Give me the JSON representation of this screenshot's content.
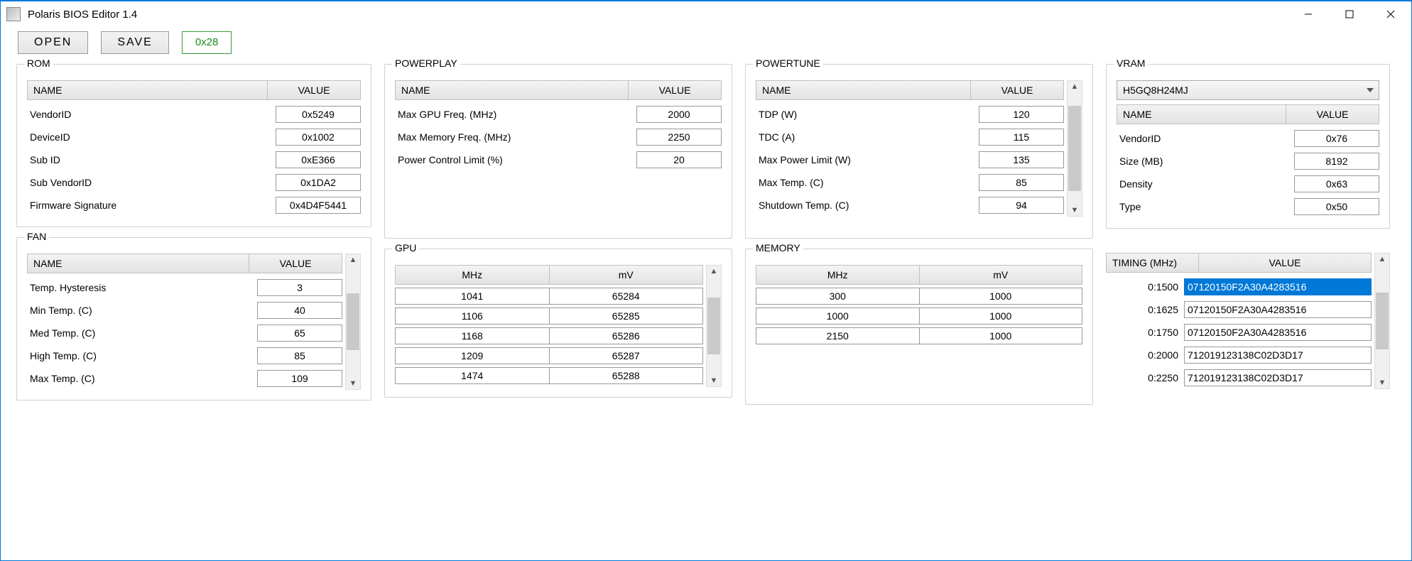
{
  "window": {
    "title": "Polaris BIOS Editor 1.4"
  },
  "toolbar": {
    "open": "OPEN",
    "save": "SAVE",
    "checksum": "0x28"
  },
  "rom": {
    "legend": "ROM",
    "headers": {
      "name": "NAME",
      "value": "VALUE"
    },
    "rows": [
      {
        "name": "VendorID",
        "value": "0x5249"
      },
      {
        "name": "DeviceID",
        "value": "0x1002"
      },
      {
        "name": "Sub ID",
        "value": "0xE366"
      },
      {
        "name": "Sub VendorID",
        "value": "0x1DA2"
      },
      {
        "name": "Firmware Signature",
        "value": "0x4D4F5441"
      }
    ]
  },
  "powerplay": {
    "legend": "POWERPLAY",
    "headers": {
      "name": "NAME",
      "value": "VALUE"
    },
    "rows": [
      {
        "name": "Max GPU Freq. (MHz)",
        "value": "2000"
      },
      {
        "name": "Max Memory Freq. (MHz)",
        "value": "2250"
      },
      {
        "name": "Power Control Limit (%)",
        "value": "20"
      }
    ]
  },
  "powertune": {
    "legend": "POWERTUNE",
    "headers": {
      "name": "NAME",
      "value": "VALUE"
    },
    "rows": [
      {
        "name": "TDP (W)",
        "value": "120"
      },
      {
        "name": "TDC (A)",
        "value": "115"
      },
      {
        "name": "Max Power Limit (W)",
        "value": "135"
      },
      {
        "name": "Max Temp. (C)",
        "value": "85"
      },
      {
        "name": "Shutdown Temp. (C)",
        "value": "94"
      }
    ]
  },
  "vram": {
    "legend": "VRAM",
    "selected": "H5GQ8H24MJ",
    "headers": {
      "name": "NAME",
      "value": "VALUE"
    },
    "rows": [
      {
        "name": "VendorID",
        "value": "0x76"
      },
      {
        "name": "Size (MB)",
        "value": "8192"
      },
      {
        "name": "Density",
        "value": "0x63"
      },
      {
        "name": "Type",
        "value": "0x50"
      }
    ]
  },
  "fan": {
    "legend": "FAN",
    "headers": {
      "name": "NAME",
      "value": "VALUE"
    },
    "rows": [
      {
        "name": "Temp. Hysteresis",
        "value": "3"
      },
      {
        "name": "Min Temp. (C)",
        "value": "40"
      },
      {
        "name": "Med Temp. (C)",
        "value": "65"
      },
      {
        "name": "High Temp. (C)",
        "value": "85"
      },
      {
        "name": "Max Temp. (C)",
        "value": "109"
      }
    ]
  },
  "gpu": {
    "legend": "GPU",
    "headers": {
      "c1": "MHz",
      "c2": "mV"
    },
    "rows": [
      {
        "mhz": "1041",
        "mv": "65284"
      },
      {
        "mhz": "1106",
        "mv": "65285"
      },
      {
        "mhz": "1168",
        "mv": "65286"
      },
      {
        "mhz": "1209",
        "mv": "65287"
      },
      {
        "mhz": "1474",
        "mv": "65288"
      }
    ]
  },
  "memory": {
    "legend": "MEMORY",
    "headers": {
      "c1": "MHz",
      "c2": "mV"
    },
    "rows": [
      {
        "mhz": "300",
        "mv": "1000"
      },
      {
        "mhz": "1000",
        "mv": "1000"
      },
      {
        "mhz": "2150",
        "mv": "1000"
      }
    ]
  },
  "timing": {
    "headers": {
      "c1": "TIMING (MHz)",
      "c2": "VALUE"
    },
    "rows": [
      {
        "strap": "0:1500",
        "value": "07120150F2A30A4283516",
        "selected": true
      },
      {
        "strap": "0:1625",
        "value": "07120150F2A30A4283516",
        "selected": false
      },
      {
        "strap": "0:1750",
        "value": "07120150F2A30A4283516",
        "selected": false
      },
      {
        "strap": "0:2000",
        "value": "712019123138C02D3D17",
        "selected": false
      },
      {
        "strap": "0:2250",
        "value": "712019123138C02D3D17",
        "selected": false
      }
    ]
  }
}
